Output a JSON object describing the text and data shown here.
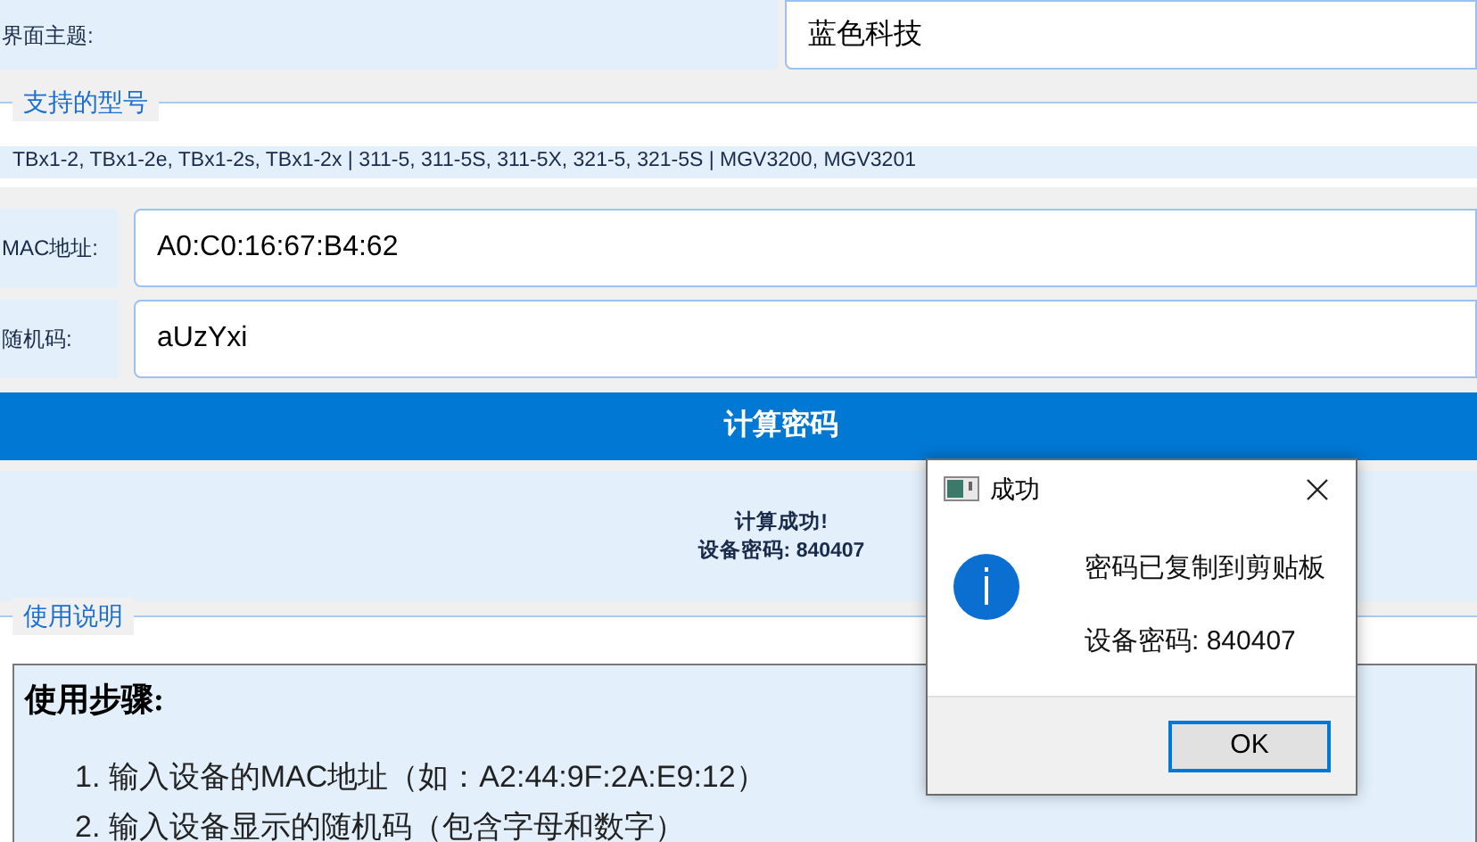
{
  "theme": {
    "label": "界面主题:",
    "value": "蓝色科技"
  },
  "models": {
    "title": "支持的型号",
    "text": "TBx1-2, TBx1-2e, TBx1-2s, TBx1-2x | 311-5, 311-5S, 311-5X, 321-5, 321-5S | MGV3200, MGV3201"
  },
  "fields": [
    {
      "label": "MAC地址:",
      "value": "A0:C0:16:67:B4:62"
    },
    {
      "label": "随机码:",
      "value": "aUzYxi"
    }
  ],
  "calculate_button": "计算密码",
  "result": {
    "line1": "计算成功!",
    "line2": "设备密码: 840407"
  },
  "usage": {
    "title": "使用说明",
    "heading": "使用步骤:",
    "steps": [
      "1. 输入设备的MAC地址（如：A2:44:9F:2A:E9:12）",
      "2. 输入设备显示的随机码（包含字母和数字）"
    ]
  },
  "dialog": {
    "title": "成功",
    "message": "密码已复制到剪贴板",
    "detail": "设备密码: 840407",
    "ok": "OK"
  }
}
